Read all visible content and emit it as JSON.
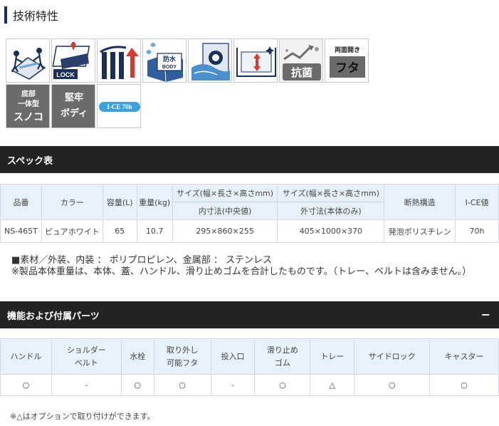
{
  "tech": {
    "title": "技術特性",
    "icons": {
      "lock": "LOCK",
      "waterproof_top": "防水",
      "waterproof_bottom": "BODY",
      "antibac": "抗菌",
      "lid_line1": "両面開き",
      "lid_line2": "フタ",
      "sunoko_line1": "底部",
      "sunoko_line2": "一体型",
      "sunoko_line3": "スノコ",
      "body_line1": "堅牢",
      "body_line2": "ボディ",
      "ice": "I-CE 70h"
    }
  },
  "spec": {
    "heading": "スペック表",
    "headers": {
      "product": "品番",
      "color": "カラー",
      "capacity": "容量(L)",
      "weight": "重量(kg)",
      "inner_size": "サイズ(幅×長さ×高さmm)",
      "inner_note": "内寸法(中央値)",
      "outer_size": "サイズ(幅×長さ×高さmm)",
      "outer_note": "外寸法(本体のみ)",
      "insulation": "断熱構造",
      "ice": "I-CE値"
    },
    "row": {
      "product": "NS-465T",
      "color": "ピュアホワイト",
      "capacity": "65",
      "weight": "10.7",
      "inner": "295×860×255",
      "outer": "405×1000×370",
      "insulation": "発泡ポリスチレン",
      "ice": "70h"
    },
    "note1": "■素材／外装、内装 ： ポリプロピレン、金属部 ： ステンレス",
    "note2": "※製品本体重量は、本体、蓋、ハンドル、滑り止めゴムを合計したものです。（トレー、ベルトは含みません。）"
  },
  "parts": {
    "heading": "機能および付属パーツ",
    "toggle": "−",
    "headers": {
      "handle": "ハンドル",
      "shoulder1": "ショルダー",
      "shoulder2": "ベルト",
      "drain": "水栓",
      "lid1": "取り外し",
      "lid2": "可能フタ",
      "inlet": "投入口",
      "rubber1": "滑り止め",
      "rubber2": "ゴム",
      "tray": "トレー",
      "sidelock": "サイドロック",
      "caster": "キャスター"
    },
    "values": {
      "handle": "○",
      "shoulder": "-",
      "drain": "○",
      "lid": "○",
      "inlet": "-",
      "rubber": "○",
      "tray": "△",
      "sidelock": "○",
      "caster": "○"
    },
    "footnote": "※△はオプションで取り付けができます。"
  }
}
